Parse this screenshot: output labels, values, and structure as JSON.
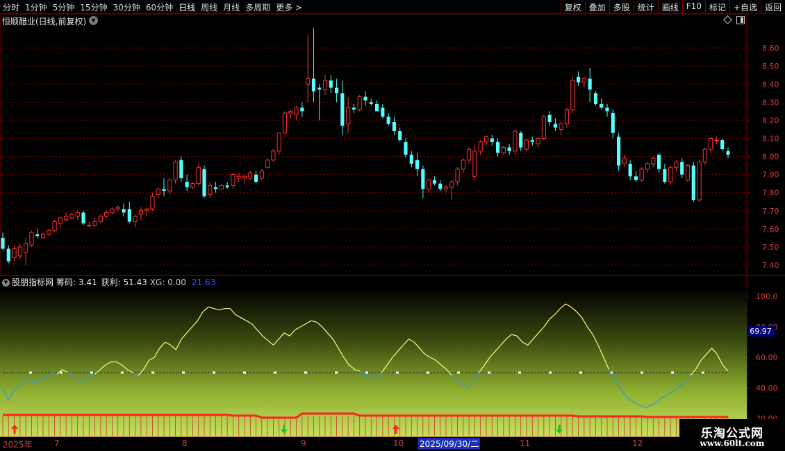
{
  "toolbar": {
    "periods": [
      "分时",
      "1分钟",
      "5分钟",
      "15分钟",
      "30分钟",
      "60分钟",
      "日线",
      "周线",
      "月线",
      "多周期",
      "更多 >"
    ],
    "active_period": "日线",
    "actions": [
      "复权",
      "叠加",
      "多股",
      "统计",
      "画线",
      "F10",
      "标记",
      "+自选",
      "返回"
    ]
  },
  "stock_panel": {
    "title": "恒顺醋业(日线,前复权)",
    "price_ticks": [
      "8.60",
      "8.50",
      "8.40",
      "8.30",
      "8.20",
      "8.10",
      "8.00",
      "7.90",
      "7.80",
      "7.70",
      "7.60",
      "7.50",
      "7.40"
    ]
  },
  "indicator_panel": {
    "name": "股朋指标网",
    "chouma": "筹码: 3.41",
    "huoli": "获利: 51.43",
    "xg": "XG: 0.00",
    "extra": "21.63",
    "ticks": [
      "100.0",
      "80.00",
      "60.00",
      "40.00",
      "20.00"
    ],
    "readout": "69.97"
  },
  "date_axis": {
    "labels": [
      "2025年",
      "7",
      "8",
      "9",
      "10",
      "11",
      "12"
    ],
    "cursor_date": "2025/09/30/二"
  },
  "watermark": {
    "brand": "乐淘公式网",
    "url": "www.60lt.com"
  },
  "colors": {
    "up": "#ff3232",
    "down": "#54ffff",
    "grid": "#7a0000",
    "line_yellow": "#ffff80",
    "line_blue": "#2a9adf",
    "bar_red": "#ff2020"
  },
  "chart_data": [
    {
      "type": "candlestick",
      "title": "恒顺醋业(日线,前复权)",
      "ylim": [
        7.35,
        8.75
      ],
      "candles": [
        [
          7.55,
          7.58,
          7.48,
          7.49
        ],
        [
          7.49,
          7.51,
          7.41,
          7.42
        ],
        [
          7.44,
          7.51,
          7.42,
          7.49
        ],
        [
          7.45,
          7.52,
          7.43,
          7.5
        ],
        [
          7.47,
          7.55,
          7.4,
          7.52
        ],
        [
          7.51,
          7.59,
          7.5,
          7.58
        ],
        [
          7.57,
          7.6,
          7.55,
          7.56
        ],
        [
          7.55,
          7.58,
          7.55,
          7.57
        ],
        [
          7.57,
          7.6,
          7.56,
          7.59
        ],
        [
          7.59,
          7.65,
          7.58,
          7.64
        ],
        [
          7.63,
          7.67,
          7.61,
          7.66
        ],
        [
          7.65,
          7.69,
          7.64,
          7.67
        ],
        [
          7.66,
          7.69,
          7.65,
          7.68
        ],
        [
          7.67,
          7.7,
          7.65,
          7.69
        ],
        [
          7.69,
          7.7,
          7.62,
          7.63
        ],
        [
          7.62,
          7.64,
          7.61,
          7.62
        ],
        [
          7.62,
          7.66,
          7.61,
          7.64
        ],
        [
          7.64,
          7.68,
          7.63,
          7.67
        ],
        [
          7.67,
          7.7,
          7.66,
          7.69
        ],
        [
          7.69,
          7.72,
          7.68,
          7.71
        ],
        [
          7.71,
          7.73,
          7.7,
          7.72
        ],
        [
          7.71,
          7.74,
          7.67,
          7.69
        ],
        [
          7.71,
          7.75,
          7.63,
          7.64
        ],
        [
          7.64,
          7.68,
          7.61,
          7.67
        ],
        [
          7.68,
          7.72,
          7.65,
          7.7
        ],
        [
          7.7,
          7.72,
          7.67,
          7.71
        ],
        [
          7.71,
          7.8,
          7.7,
          7.78
        ],
        [
          7.79,
          7.83,
          7.77,
          7.82
        ],
        [
          7.82,
          7.88,
          7.78,
          7.81
        ],
        [
          7.81,
          7.88,
          7.79,
          7.87
        ],
        [
          7.87,
          7.98,
          7.85,
          7.97
        ],
        [
          7.98,
          8.0,
          7.86,
          7.88
        ],
        [
          7.86,
          7.9,
          7.81,
          7.83
        ],
        [
          7.83,
          7.86,
          7.82,
          7.85
        ],
        [
          7.85,
          7.96,
          7.84,
          7.94
        ],
        [
          7.93,
          7.95,
          7.77,
          7.78
        ],
        [
          7.79,
          7.86,
          7.77,
          7.84
        ],
        [
          7.83,
          7.86,
          7.8,
          7.82
        ],
        [
          7.82,
          7.85,
          7.82,
          7.84
        ],
        [
          7.84,
          7.86,
          7.82,
          7.83
        ],
        [
          7.84,
          7.91,
          7.82,
          7.9
        ],
        [
          7.88,
          7.91,
          7.86,
          7.89
        ],
        [
          7.88,
          7.9,
          7.85,
          7.89
        ],
        [
          7.88,
          7.92,
          7.87,
          7.91
        ],
        [
          7.9,
          7.92,
          7.85,
          7.86
        ],
        [
          7.88,
          7.93,
          7.87,
          7.92
        ],
        [
          7.94,
          7.99,
          7.93,
          7.98
        ],
        [
          7.98,
          8.04,
          7.97,
          8.03
        ],
        [
          8.03,
          8.13,
          8.01,
          8.13
        ],
        [
          8.13,
          8.25,
          8.12,
          8.24
        ],
        [
          8.24,
          8.26,
          8.21,
          8.25
        ],
        [
          8.23,
          8.28,
          8.2,
          8.27
        ],
        [
          8.27,
          8.3,
          8.22,
          8.25
        ],
        [
          8.4,
          8.67,
          8.3,
          8.43
        ],
        [
          8.43,
          8.71,
          8.3,
          8.36
        ],
        [
          8.38,
          8.4,
          8.2,
          8.37
        ],
        [
          8.37,
          8.45,
          8.34,
          8.42
        ],
        [
          8.42,
          8.45,
          8.35,
          8.38
        ],
        [
          8.38,
          8.43,
          8.3,
          8.35
        ],
        [
          8.35,
          8.42,
          8.12,
          8.17
        ],
        [
          8.18,
          8.33,
          8.13,
          8.27
        ],
        [
          8.27,
          8.29,
          8.24,
          8.26
        ],
        [
          8.26,
          8.34,
          8.25,
          8.33
        ],
        [
          8.33,
          8.36,
          8.28,
          8.31
        ],
        [
          8.3,
          8.32,
          8.28,
          8.29
        ],
        [
          8.29,
          8.31,
          8.25,
          8.25
        ],
        [
          8.27,
          8.29,
          8.21,
          8.22
        ],
        [
          8.22,
          8.24,
          8.17,
          8.18
        ],
        [
          8.19,
          8.22,
          8.12,
          8.14
        ],
        [
          8.14,
          8.16,
          8.08,
          8.09
        ],
        [
          8.08,
          8.1,
          7.99,
          8.01
        ],
        [
          8.01,
          8.03,
          7.94,
          7.96
        ],
        [
          7.98,
          8.02,
          7.89,
          7.93
        ],
        [
          7.93,
          7.95,
          7.77,
          7.82
        ],
        [
          7.82,
          7.88,
          7.8,
          7.87
        ],
        [
          7.87,
          7.89,
          7.84,
          7.85
        ],
        [
          7.85,
          7.87,
          7.81,
          7.82
        ],
        [
          7.82,
          7.84,
          7.8,
          7.83
        ],
        [
          7.83,
          7.87,
          7.76,
          7.86
        ],
        [
          7.86,
          7.94,
          7.84,
          7.93
        ],
        [
          7.93,
          7.99,
          7.91,
          7.98
        ],
        [
          7.98,
          8.05,
          7.96,
          8.04
        ],
        [
          7.89,
          8.06,
          7.87,
          8.03
        ],
        [
          8.03,
          8.09,
          8.01,
          8.08
        ],
        [
          8.08,
          8.12,
          8.06,
          8.11
        ],
        [
          8.1,
          8.12,
          8.06,
          8.08
        ],
        [
          8.08,
          8.1,
          8.0,
          8.02
        ],
        [
          8.02,
          8.06,
          8.01,
          8.05
        ],
        [
          8.05,
          8.07,
          8.01,
          8.03
        ],
        [
          8.03,
          8.15,
          8.01,
          8.14
        ],
        [
          8.13,
          8.14,
          8.03,
          8.05
        ],
        [
          8.04,
          8.1,
          8.03,
          8.09
        ],
        [
          8.09,
          8.11,
          8.06,
          8.08
        ],
        [
          8.07,
          8.11,
          8.05,
          8.1
        ],
        [
          8.1,
          8.23,
          8.09,
          8.22
        ],
        [
          8.23,
          8.25,
          8.17,
          8.19
        ],
        [
          8.18,
          8.21,
          8.14,
          8.16
        ],
        [
          8.15,
          8.19,
          8.12,
          8.18
        ],
        [
          8.18,
          8.27,
          8.16,
          8.26
        ],
        [
          8.26,
          8.44,
          8.24,
          8.42
        ],
        [
          8.44,
          8.47,
          8.39,
          8.41
        ],
        [
          8.41,
          8.44,
          8.38,
          8.43
        ],
        [
          8.43,
          8.49,
          8.3,
          8.37
        ],
        [
          8.35,
          8.36,
          8.28,
          8.29
        ],
        [
          8.29,
          8.32,
          8.26,
          8.27
        ],
        [
          8.27,
          8.29,
          8.22,
          8.25
        ],
        [
          8.24,
          8.26,
          8.1,
          8.13
        ],
        [
          8.11,
          8.13,
          7.92,
          7.95
        ],
        [
          7.96,
          8.01,
          7.94,
          7.99
        ],
        [
          7.96,
          7.98,
          7.87,
          7.89
        ],
        [
          7.89,
          7.92,
          7.86,
          7.87
        ],
        [
          7.87,
          7.94,
          7.86,
          7.93
        ],
        [
          7.93,
          7.97,
          7.91,
          7.96
        ],
        [
          7.96,
          8.0,
          7.94,
          7.99
        ],
        [
          8.01,
          8.02,
          7.91,
          7.93
        ],
        [
          7.93,
          7.96,
          7.85,
          7.86
        ],
        [
          7.86,
          7.95,
          7.84,
          7.94
        ],
        [
          7.94,
          7.98,
          7.92,
          7.97
        ],
        [
          7.97,
          7.99,
          7.88,
          7.9
        ],
        [
          7.87,
          7.96,
          7.86,
          7.95
        ],
        [
          7.95,
          7.97,
          7.75,
          7.76
        ],
        [
          7.76,
          7.98,
          7.75,
          7.97
        ],
        [
          7.97,
          8.05,
          7.95,
          8.04
        ],
        [
          8.04,
          8.11,
          8.02,
          8.1
        ],
        [
          8.09,
          8.11,
          8.07,
          8.09
        ],
        [
          8.09,
          8.1,
          8.03,
          8.04
        ],
        [
          8.03,
          8.05,
          7.99,
          8.01
        ]
      ]
    },
    {
      "type": "line",
      "title": "股朋指标网",
      "ylim": [
        10,
        110
      ],
      "series": [
        {
          "name": "获利",
          "values": [
            40,
            32,
            38,
            41,
            44,
            46,
            43,
            45,
            48,
            50,
            49,
            52,
            50,
            48,
            44,
            45,
            47,
            49,
            52,
            55,
            57,
            57,
            55,
            52,
            50,
            48,
            52,
            58,
            60,
            66,
            70,
            68,
            65,
            72,
            76,
            80,
            84,
            90,
            93,
            92,
            91,
            92,
            92,
            88,
            86,
            84,
            82,
            78,
            74,
            71,
            68,
            72,
            76,
            74,
            78,
            80,
            82,
            84,
            83,
            80,
            76,
            72,
            66,
            60,
            55,
            52,
            51,
            48,
            46,
            45,
            50,
            55,
            60,
            64,
            68,
            72,
            70,
            66,
            62,
            60,
            58,
            55,
            52,
            48,
            45,
            42,
            40,
            45,
            50,
            55,
            60,
            64,
            68,
            72,
            75,
            74,
            70,
            68,
            72,
            76,
            80,
            85,
            88,
            92,
            95,
            93,
            90,
            86,
            80,
            75,
            68,
            60,
            52,
            46,
            40,
            35,
            32,
            30,
            28,
            27,
            29,
            31,
            34,
            36,
            38,
            40,
            44,
            48,
            52,
            58,
            62,
            66,
            62,
            55,
            51
          ]
        }
      ],
      "reference_line": 50
    }
  ]
}
